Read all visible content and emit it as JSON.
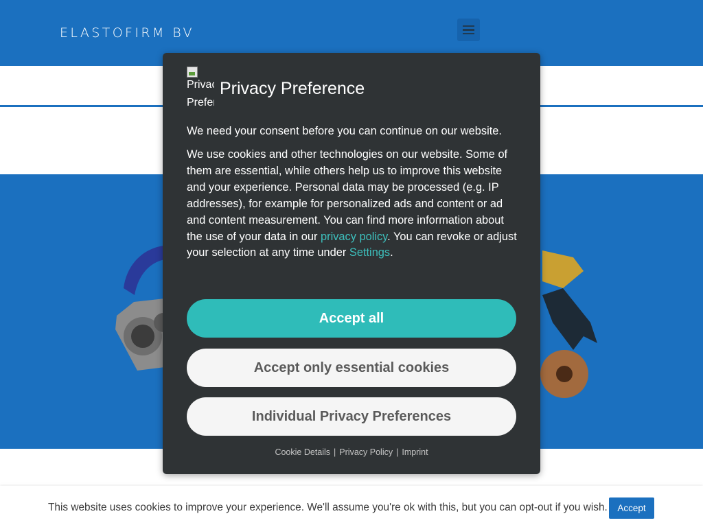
{
  "header": {
    "logo_text": "ELASTOFIRM BV",
    "menu_icon": "hamburger-menu-icon"
  },
  "modal": {
    "image_alt": "Privacy Preference",
    "title": "Privacy Preference",
    "consent_line": "We need your consent before you can continue on our website.",
    "body_part1": "We use cookies and other technologies on our website. Some of them are essential, while others help us to improve this website and your experience. Personal data may be processed (e.g. IP addresses), for example for personalized ads and content or ad and content measurement. You can find more information about the use of your data in our ",
    "privacy_policy_link": "privacy policy",
    "body_part2": ". You can revoke or adjust your selection at any time under ",
    "settings_link": "Settings",
    "body_part3": ".",
    "buttons": {
      "accept_all": "Accept all",
      "accept_essential": "Accept only essential cookies",
      "individual": "Individual Privacy Preferences"
    },
    "footer": {
      "cookie_details": "Cookie Details",
      "privacy_policy": "Privacy Policy",
      "imprint": "Imprint",
      "separator": "|"
    }
  },
  "cookie_bar": {
    "text": "This website uses cookies to improve your experience. We'll assume you're ok with this, but you can opt-out if you wish.",
    "accept_label": "Accept"
  },
  "colors": {
    "brand_blue": "#1b70bf",
    "modal_bg": "#2f3335",
    "accent_teal": "#2fbcb9",
    "link_teal": "#3dc0bd"
  }
}
